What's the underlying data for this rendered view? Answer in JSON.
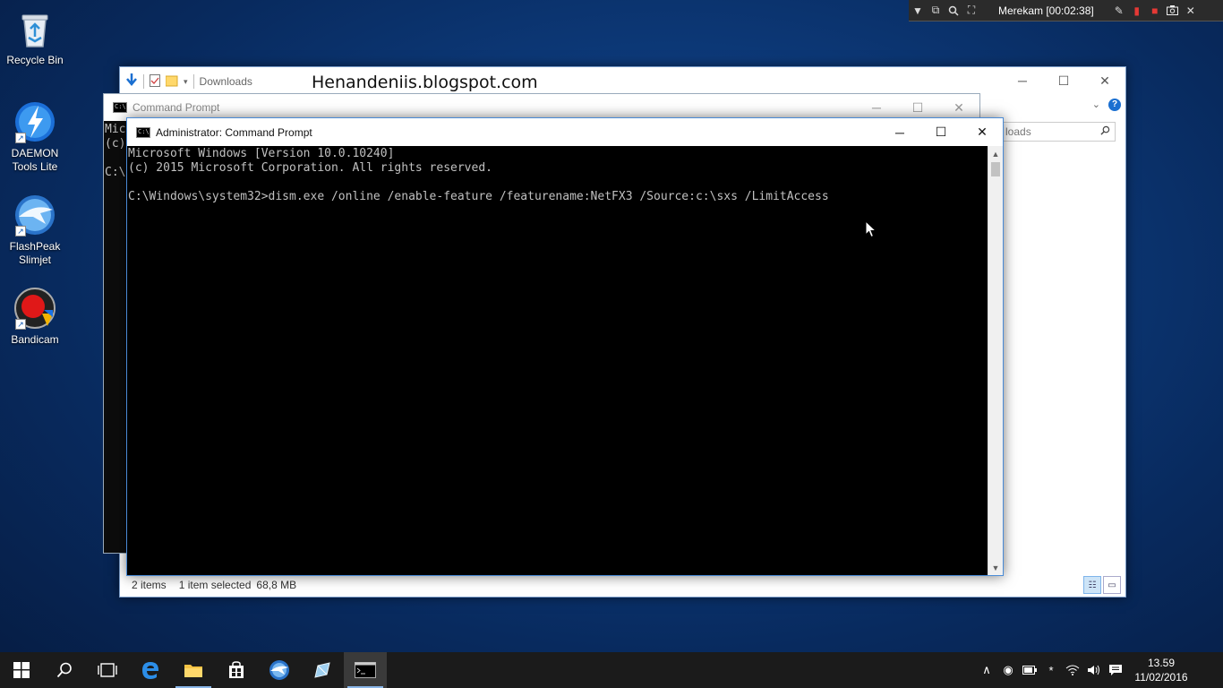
{
  "desktop": {
    "icons": [
      {
        "label": "Recycle Bin"
      },
      {
        "label": "DAEMON Tools Lite"
      },
      {
        "label": "FlashPeak Slimjet"
      },
      {
        "label": "Bandicam"
      }
    ]
  },
  "recorder": {
    "label": "Merekam [00:02:38]"
  },
  "explorer": {
    "title": "Downloads",
    "watermark": "Henandeniis.blogspot.com",
    "search_placeholder": "loads",
    "status_items": "2 items",
    "status_selected": "1 item selected",
    "status_size": "68,8 MB"
  },
  "cmd_back": {
    "title": "Command Prompt",
    "lines": "Mic\n(c)\n\nC:\\"
  },
  "cmd_front": {
    "title": "Administrator: Command Prompt",
    "lines": "Microsoft Windows [Version 10.0.10240]\n(c) 2015 Microsoft Corporation. All rights reserved.\n\nC:\\Windows\\system32>dism.exe /online /enable-feature /featurename:NetFX3 /Source:c:\\sxs /LimitAccess"
  },
  "taskbar": {
    "time": "13.59",
    "date": "11/02/2016"
  },
  "colors": {
    "accent": "#1a6fd1",
    "taskbar": "#1b1b1b",
    "console_text": "#c0c0c0"
  }
}
